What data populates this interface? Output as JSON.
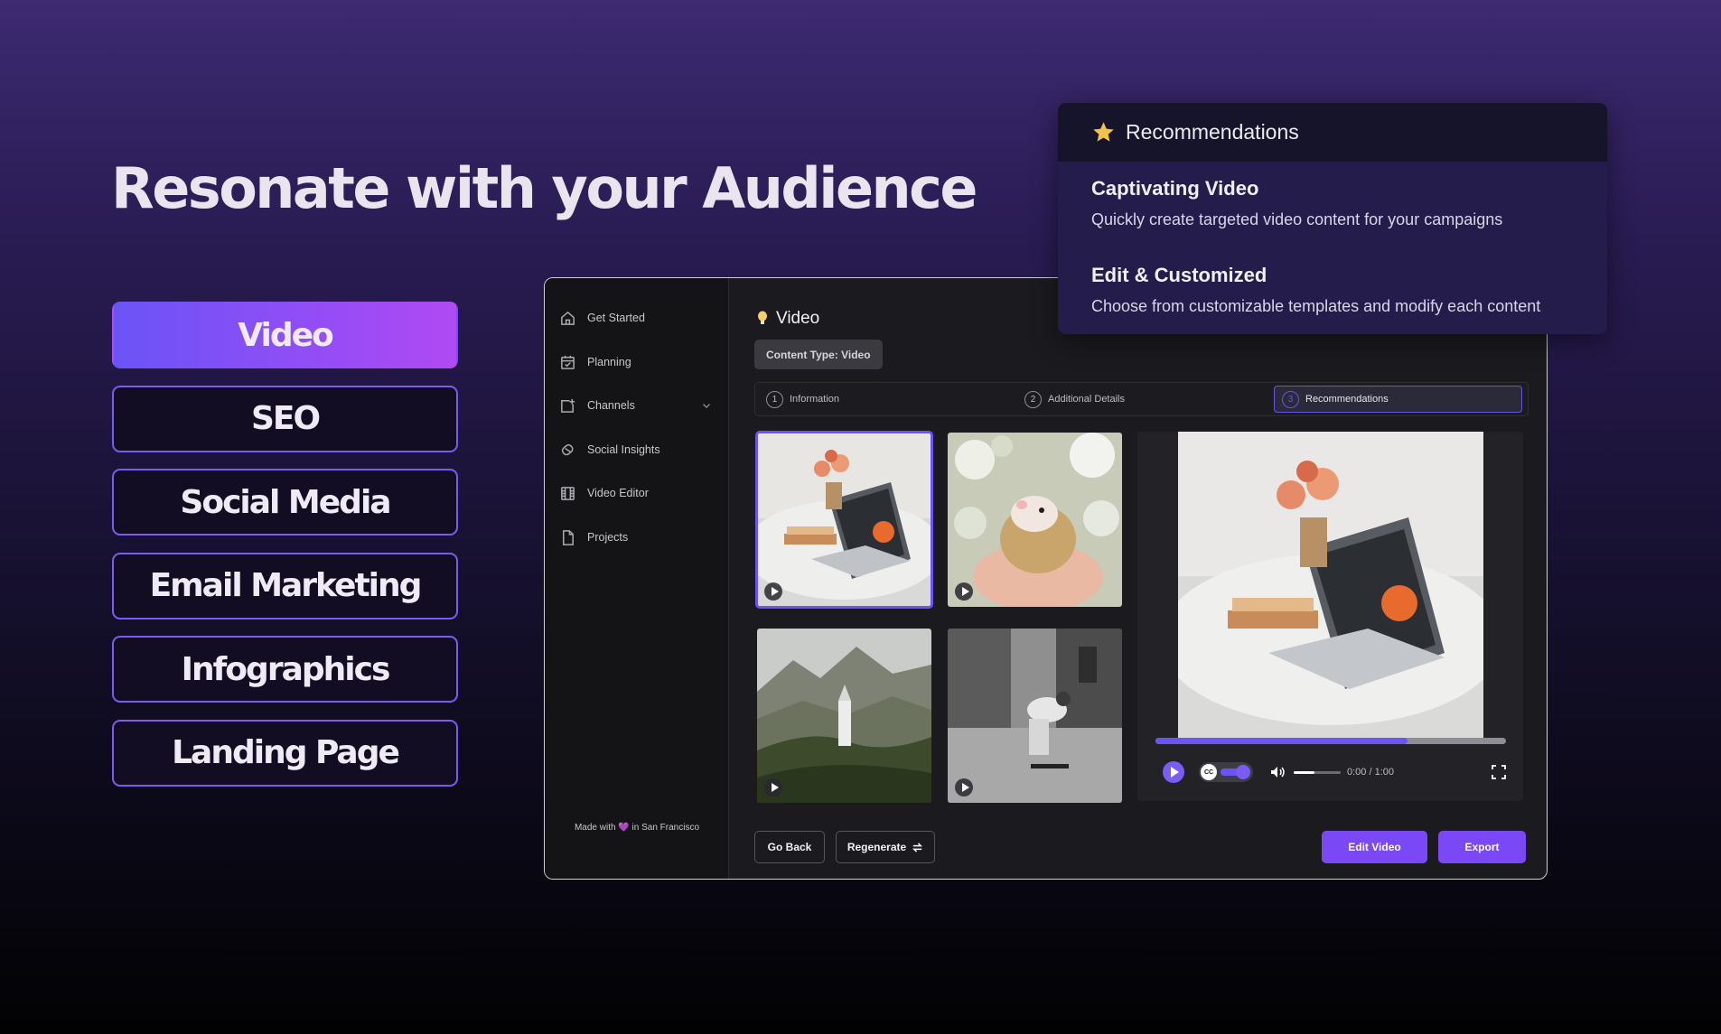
{
  "headline": "Resonate with your Audience",
  "categories": [
    {
      "label": "Video",
      "active": true
    },
    {
      "label": "SEO",
      "active": false
    },
    {
      "label": "Social Media",
      "active": false
    },
    {
      "label": "Email Marketing",
      "active": false
    },
    {
      "label": "Infographics",
      "active": false
    },
    {
      "label": "Landing Page",
      "active": false
    }
  ],
  "sidebar": {
    "items": [
      {
        "label": "Get Started",
        "icon": "home-icon"
      },
      {
        "label": "Planning",
        "icon": "calendar-icon"
      },
      {
        "label": "Channels",
        "icon": "channels-icon"
      },
      {
        "label": "Social Insights",
        "icon": "insights-icon"
      },
      {
        "label": "Video Editor",
        "icon": "film-icon"
      },
      {
        "label": "Projects",
        "icon": "file-icon"
      }
    ],
    "footer": {
      "prefix": "Made with",
      "heart": "💜",
      "suffix": "in San Francisco"
    }
  },
  "main": {
    "title": "Video",
    "content_type": "Content Type: Video",
    "steps": [
      {
        "num": "1",
        "label": "Information"
      },
      {
        "num": "2",
        "label": "Additional Details"
      },
      {
        "num": "3",
        "label": "Recommendations"
      }
    ],
    "active_step": 2,
    "thumbnails": [
      "laptop-flowers",
      "hedgehog",
      "mountain-church",
      "skateboarder"
    ],
    "selected_thumbnail": 0
  },
  "player": {
    "progress": 0.72,
    "volume": 0.45,
    "time": "0:00 / 1:00",
    "cc_label": "CC"
  },
  "buttons": {
    "go_back": "Go Back",
    "regenerate": "Regenerate",
    "edit_video": "Edit Video",
    "export": "Export"
  },
  "recommendations": {
    "title": "Recommendations",
    "items": [
      {
        "heading": "Captivating Video",
        "desc": "Quickly create targeted video content for your campaigns"
      },
      {
        "heading": "Edit & Customized",
        "desc": "Choose from customizable templates and modify each content"
      }
    ]
  },
  "colors": {
    "accent": "#6a54f6",
    "accent2": "#b14af3",
    "export": "#7b48f5"
  }
}
